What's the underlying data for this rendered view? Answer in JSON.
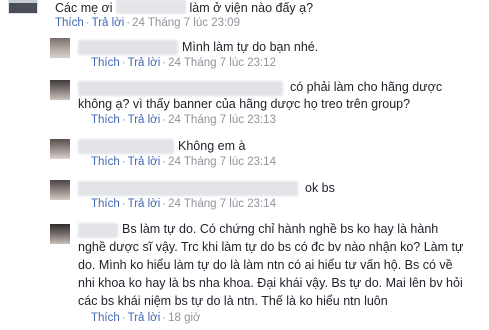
{
  "top_comment": {
    "text_before": "Các mẹ ơi",
    "text_after": "làm ở viện nào đấy ạ?",
    "like": "Thích",
    "reply": "Trả lời",
    "time": "24 Tháng 7 lúc 23:09"
  },
  "replies": [
    {
      "text": "Mình làm tự do bạn nhé.",
      "like": "Thích",
      "reply": "Trả lời",
      "time": "24 Tháng 7 lúc 23:12"
    },
    {
      "text_line1": "có phải làm cho hãng dược",
      "text_line2": "không ạ? vì thấy banner của hãng dược họ treo trên group?",
      "like": "Thích",
      "reply": "Trả lời",
      "time": "24 Tháng 7 lúc 23:13"
    },
    {
      "text": "Không em à",
      "like": "Thích",
      "reply": "Trả lời",
      "time": "24 Tháng 7 lúc 23:14"
    },
    {
      "text": "ok bs",
      "like": "Thích",
      "reply": "Trả lời",
      "time": "24 Tháng 7 lúc 23:14"
    },
    {
      "lines": [
        "Bs làm tự do. Có chứng chỉ hành nghề bs ko hay là hành",
        "nghề dược sĩ vậy. Trc khi làm tự do bs có đc bv nào nhận ko? Làm tự",
        "do. Mình ko hiểu làm tự do là làm ntn có ai hiểu tư vấn hộ. Bs có về",
        "nhi khoa ko hay là bs nha khoa. Đại khái vậy. Bs tự do. Mai lên bv hỏi",
        "các bs khái niệm bs tự do là ntn. Thế là ko hiểu ntn luôn"
      ],
      "like": "Thích",
      "reply": "Trả lời",
      "time": "18 giờ"
    }
  ],
  "colors": {
    "link": "#4267b2",
    "meta": "#90949c",
    "text": "#1d2129"
  }
}
